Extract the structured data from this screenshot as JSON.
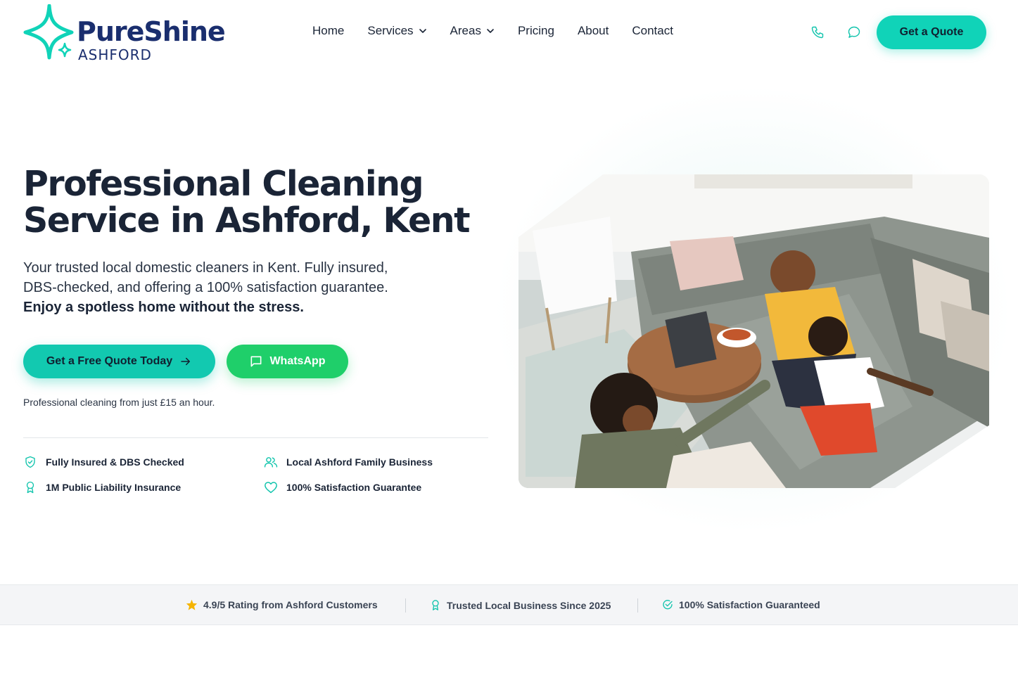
{
  "brand": {
    "name": "PureShine",
    "location": "ASHFORD",
    "accent": "#10d3b8",
    "navy": "#1a2e6e",
    "whatsapp_green": "#1fcf6a"
  },
  "nav": {
    "items": [
      {
        "label": "Home"
      },
      {
        "label": "Services",
        "dropdown": true
      },
      {
        "label": "Areas",
        "dropdown": true
      },
      {
        "label": "Pricing"
      },
      {
        "label": "About"
      },
      {
        "label": "Contact"
      }
    ],
    "phone_icon": "phone-icon",
    "chat_icon": "chat-icon",
    "quote_label": "Get a Quote"
  },
  "hero": {
    "title_line1": "Professional Cleaning",
    "title_line2": "Service in Ashford, Kent",
    "subtitle_line1": "Your trusted local domestic cleaners in Kent. Fully insured,",
    "subtitle_line2": "DBS-checked, and offering a 100% satisfaction guarantee.",
    "subtitle_bold": "Enjoy a spotless home without the stress.",
    "cta_primary": "Get a Free Quote Today",
    "cta_whatsapp": "WhatsApp",
    "price_note": "Professional cleaning from just £15 an hour.",
    "features": [
      {
        "icon": "shield-check-icon",
        "label": "Fully Insured & DBS Checked"
      },
      {
        "icon": "users-icon",
        "label": "Local Ashford Family Business"
      },
      {
        "icon": "award-icon",
        "label": "1M Public Liability Insurance"
      },
      {
        "icon": "heart-icon",
        "label": "100% Satisfaction Guarantee"
      }
    ]
  },
  "trust_bar": {
    "items": [
      {
        "icon": "star-icon",
        "label": "4.9/5 Rating from Ashford Customers"
      },
      {
        "icon": "award-icon",
        "label": "Trusted Local Business Since 2025"
      },
      {
        "icon": "check-circle-icon",
        "label": "100% Satisfaction Guaranteed"
      }
    ]
  }
}
